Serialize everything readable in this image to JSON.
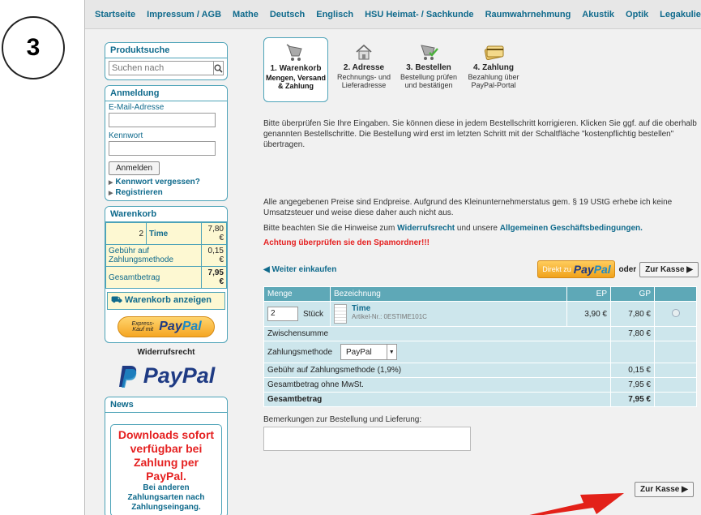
{
  "annotation": {
    "step_number": "3"
  },
  "nav": [
    "Startseite",
    "Impressum / AGB",
    "Mathe",
    "Deutsch",
    "Englisch",
    "HSU Heimat- / Sachkunde",
    "Raumwahrnehmung",
    "Akustik",
    "Optik",
    "Legakulie"
  ],
  "sidebar": {
    "search": {
      "title": "Produktsuche",
      "placeholder": "Suchen nach"
    },
    "login": {
      "title": "Anmeldung",
      "email_label": "E-Mail-Adresse",
      "password_label": "Kennwort",
      "button": "Anmelden",
      "forgot": "Kennwort vergessen?",
      "register": "Registrieren"
    },
    "cart": {
      "title": "Warenkorb",
      "item_qty": "2",
      "item_name": "Time",
      "item_price": "7,80 €",
      "fee_label": "Gebühr auf Zahlungsmethode",
      "fee_value": "0,15 €",
      "total_label": "Gesamtbetrag",
      "total_value": "7,95 €",
      "show_label": "Warenkorb anzeigen"
    },
    "paypal_express": {
      "small": "Express-Kauf mit",
      "brand_a": "Pay",
      "brand_b": "Pal"
    },
    "withdrawal": "Widerrufsrecht",
    "paypal_logo": "PayPal",
    "news": {
      "title": "News",
      "headline": "Downloads sofort verfügbar bei Zahlung per PayPal.",
      "sub": "Bei anderen Zahlungsarten nach Zahlungseingang."
    }
  },
  "steps": [
    {
      "title": "1. Warenkorb",
      "desc": "Mengen, Versand & Zahlung",
      "active": true
    },
    {
      "title": "2. Adresse",
      "desc": "Rechnungs- und Lieferadresse",
      "active": false
    },
    {
      "title": "3. Bestellen",
      "desc": "Bestellung prüfen und bestätigen",
      "active": false
    },
    {
      "title": "4. Zahlung",
      "desc": "Bezahlung über PayPal-Portal",
      "active": false
    }
  ],
  "main": {
    "intro": "Bitte überprüfen Sie Ihre Eingaben. Sie können diese in jedem Bestellschritt korrigieren. Klicken Sie ggf. auf die oberhalb genannten Bestellschritte. Die Bestellung wird erst im letzten Schritt mit der Schaltfläche \"kostenpflichtig bestellen\" übertragen.",
    "prices_note": "Alle angegebenen Preise sind Endpreise.  Aufgrund des Kleinunternehmerstatus gem. § 19 UStG erhebe ich keine Umsatzsteuer und weise diese daher auch nicht aus.",
    "hint_pre": "Bitte beachten Sie die Hinweise zum ",
    "hint_link1": "Widerrufsrecht",
    "hint_mid": " und unsere ",
    "hint_link2": "Allgemeinen Geschäftsbedingungen.",
    "spam": "Achtung überprüfen sie den Spamordner!!!",
    "back": "Weiter einkaufen",
    "direct_pre": "Direkt zu",
    "direct_brand_a": "Pay",
    "direct_brand_b": "Pal",
    "or": "oder",
    "checkout": "Zur Kasse",
    "table": {
      "headers": {
        "qty": "Menge",
        "name": "Bezeichnung",
        "ep": "EP",
        "gp": "GP"
      },
      "item": {
        "qty": "2",
        "unit": "Stück",
        "name": "Time",
        "article": "Artikel-Nr.: 0ESTIME101C",
        "ep": "3,90 €",
        "gp": "7,80 €"
      },
      "subtotal_label": "Zwischensumme",
      "subtotal": "7,80 €",
      "payment_label": "Zahlungsmethode",
      "payment_value": "PayPal",
      "fee_label": "Gebühr auf Zahlungsmethode (1,9%)",
      "fee": "0,15 €",
      "net_label": "Gesamtbetrag ohne MwSt.",
      "net": "7,95 €",
      "total_label": "Gesamtbetrag",
      "total": "7,95 €"
    },
    "remarks_label": "Bemerkungen zur Bestellung und Lieferung:",
    "checkout_bottom": "Zur Kasse"
  }
}
